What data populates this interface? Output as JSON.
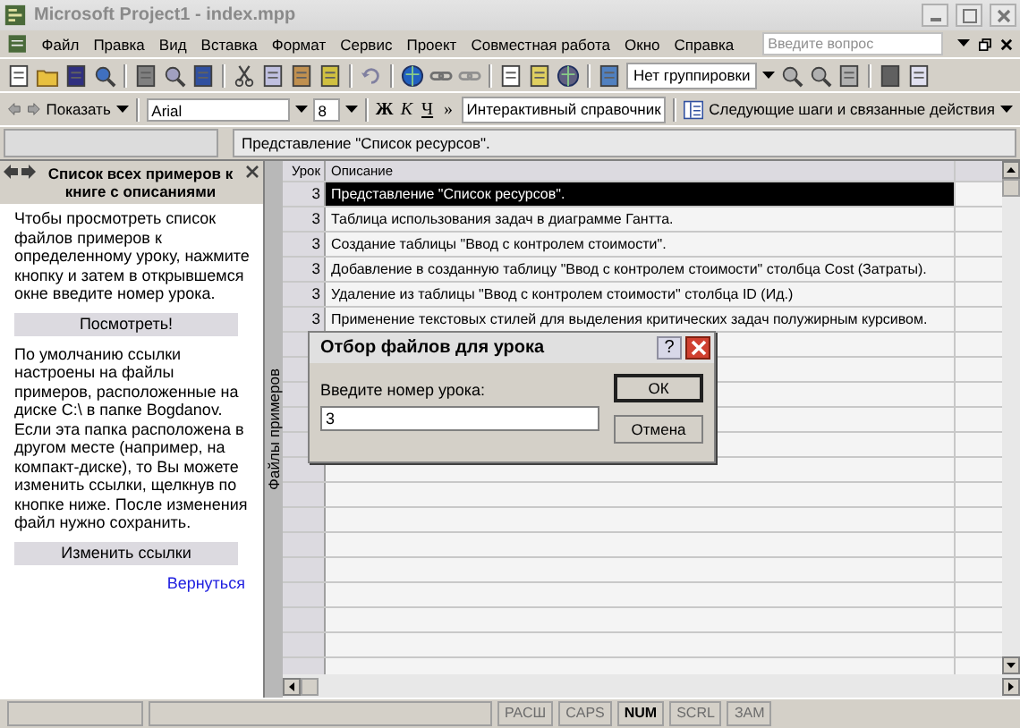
{
  "window": {
    "title": "Microsoft Project1 - index.mpp"
  },
  "menu": [
    "Файл",
    "Правка",
    "Вид",
    "Вставка",
    "Формат",
    "Сервис",
    "Проект",
    "Совместная работа",
    "Окно",
    "Справка"
  ],
  "help_search": {
    "placeholder": "Введите вопрос"
  },
  "standard_toolbar": {
    "grouping": "Нет группировки"
  },
  "formatting_toolbar": {
    "show": "Показать",
    "font": "Arial",
    "size": "8",
    "bold": "Ж",
    "italic": "К",
    "underline": "Ч",
    "more": "»",
    "help_field": "Интерактивный справочник",
    "next_steps": "Следующие шаги и связанные действия"
  },
  "entry_bar": {
    "value": "Представление \"Список ресурсов\"."
  },
  "side_pane": {
    "title": "Список всех примеров к книге с описаниями",
    "paragraph_1": "Чтобы просмотреть список файлов примеров к определенному уроку, нажмите кнопку и затем в открывшемся окне введите номер урока.",
    "view_button": "Посмотреть!",
    "paragraph_2": "По умолчанию ссылки настроены на файлы примеров, расположенные на диске C:\\ в папке Bogdanov. Если эта папка расположена в другом месте (например, на компакт-диске), то Вы можете изменить ссылки, щелкнув по кнопке ниже. После изменения файл нужно сохранить.",
    "change_button": "Изменить ссылки",
    "back_link": "Вернуться"
  },
  "side_tab": "Файлы примеров",
  "table": {
    "columns": [
      "Урок",
      "Описание"
    ],
    "rows": [
      {
        "lesson": "3",
        "description": "Представление \"Список ресурсов\".",
        "selected": true
      },
      {
        "lesson": "3",
        "description": "Таблица использования задач в диаграмме Гантта.",
        "selected": false
      },
      {
        "lesson": "3",
        "description": "Создание таблицы \"Ввод с контролем стоимости\".",
        "selected": false
      },
      {
        "lesson": "3",
        "description": "Добавление в созданную таблицу \"Ввод с контролем стоимости\" столбца Cost (Затраты).",
        "selected": false
      },
      {
        "lesson": "3",
        "description": "Удаление из таблицы \"Ввод с контролем стоимости\" столбца ID (Ид.)",
        "selected": false
      },
      {
        "lesson": "3",
        "description": "Применение текстовых стилей для выделения критических задач полужирным курсивом.",
        "selected": false
      }
    ]
  },
  "dialog": {
    "title": "Отбор файлов для урока",
    "help": "?",
    "prompt": "Введите номер урока:",
    "value": "3",
    "buttons": [
      "ОК",
      "Отмена"
    ]
  },
  "status_bar": {
    "indicators": [
      {
        "label": "РАСШ",
        "on": false
      },
      {
        "label": "CAPS",
        "on": false
      },
      {
        "label": "NUM",
        "on": true
      },
      {
        "label": "SCRL",
        "on": false
      },
      {
        "label": "ЗАМ",
        "on": false
      }
    ]
  }
}
